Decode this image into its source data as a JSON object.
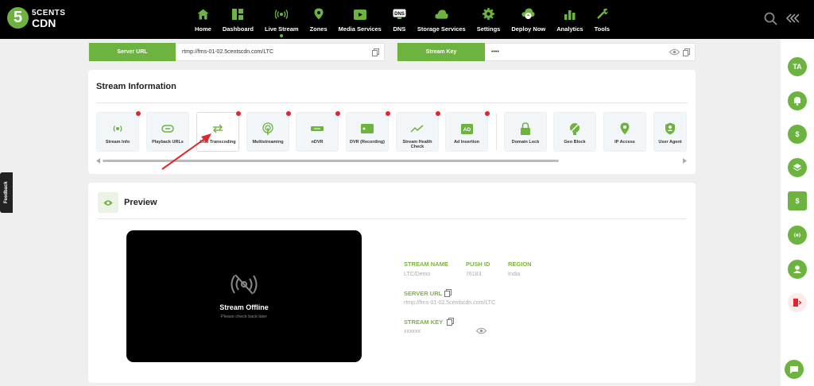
{
  "brand": {
    "line1": "5CENTS",
    "line2": "CDN",
    "digit": "5"
  },
  "nav": [
    {
      "label": "Home",
      "icon": "home-icon"
    },
    {
      "label": "Dashboard",
      "icon": "dashboard-icon"
    },
    {
      "label": "Live Stream",
      "icon": "live-stream-icon",
      "active": true
    },
    {
      "label": "Zones",
      "icon": "zones-icon"
    },
    {
      "label": "Media Services",
      "icon": "media-services-icon"
    },
    {
      "label": "DNS",
      "icon": "dns-icon"
    },
    {
      "label": "Storage Services",
      "icon": "storage-icon"
    },
    {
      "label": "Settings",
      "icon": "settings-icon"
    },
    {
      "label": "Deploy Now",
      "icon": "deploy-icon"
    },
    {
      "label": "Analytics",
      "icon": "analytics-icon"
    },
    {
      "label": "Tools",
      "icon": "tools-icon"
    }
  ],
  "server_url": {
    "label": "Server URL",
    "value": "rtmp://fms-01-02.5centscdn.com/LTC"
  },
  "stream_key": {
    "label": "Stream Key",
    "value": "••••"
  },
  "stream_info": {
    "title": "Stream Information",
    "tiles": [
      {
        "label": "Stream Info",
        "dot": true
      },
      {
        "label": "Playback URLs",
        "dot": false
      },
      {
        "label": "Live Transcoding",
        "dot": true
      },
      {
        "label": "Multistreaming",
        "dot": true
      },
      {
        "label": "nDVR",
        "dot": true
      },
      {
        "label": "DVR (Recording)",
        "dot": true
      },
      {
        "label": "Stream Health Check",
        "dot": true
      },
      {
        "label": "Ad Insertion",
        "dot": true
      },
      {
        "label": "Domain Lock",
        "dot": false
      },
      {
        "label": "Geo Block",
        "dot": false
      },
      {
        "label": "IP Access",
        "dot": false
      },
      {
        "label": "User Agent",
        "dot": false
      }
    ]
  },
  "preview": {
    "title": "Preview",
    "offline_title": "Stream Offline",
    "offline_sub": "Please check back later",
    "stream_name_label": "STREAM NAME",
    "stream_name": "LTC/Demo",
    "push_id_label": "PUSH ID",
    "push_id": "76183",
    "region_label": "REGION",
    "region": "India",
    "server_url_label": "SERVER URL",
    "server_url": "rtmp://fms-01-02.5centscdn.com/LTC",
    "stream_key_label": "STREAM KEY",
    "stream_key": "xxxxxx"
  },
  "avatar": "TA",
  "feedback": "Feedback",
  "colors": {
    "accent": "#6db33f",
    "dot": "#e0262b",
    "topbar": "#000000"
  }
}
